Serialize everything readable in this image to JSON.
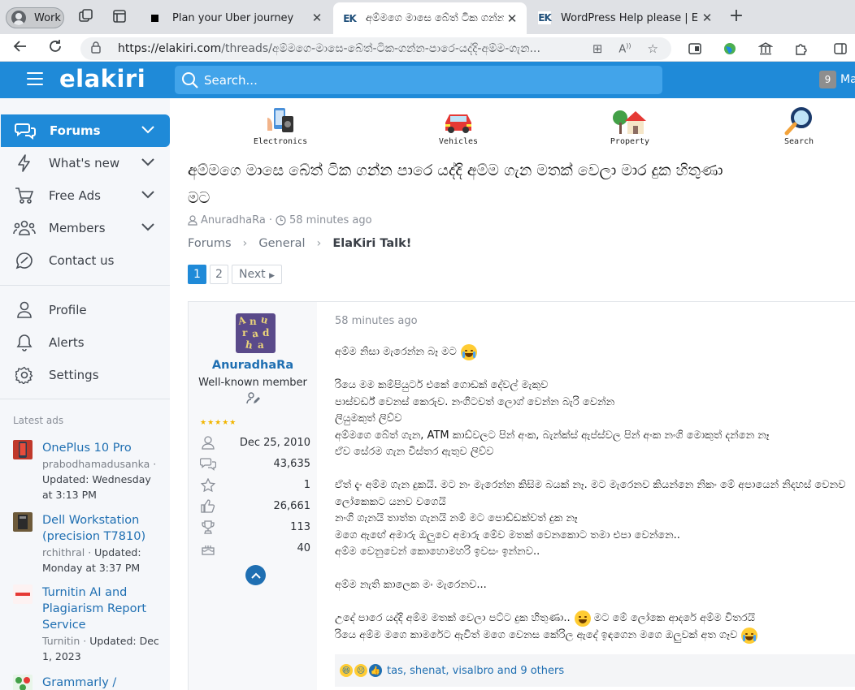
{
  "browser": {
    "profile_label": "Work",
    "tabs": [
      {
        "title": "Plan your Uber journey"
      },
      {
        "title": "අම්මගෙ මාසෙ බේත් ටික ගන්න"
      },
      {
        "title": "WordPress Help please | ElaKiri"
      }
    ],
    "url_host": "https://elakiri.com",
    "url_path": "/threads/අම්මගෙ-මාසෙ-බේත්-ටික-ගන්න-පාරෙ-යද්දි-අම්ම-ගැන..."
  },
  "header": {
    "logo": "elakiri",
    "search_placeholder": "Search...",
    "notification_count": "9",
    "user_truncated": "Ma"
  },
  "sidebar": {
    "items": [
      {
        "label": "Forums"
      },
      {
        "label": "What's new"
      },
      {
        "label": "Free Ads"
      },
      {
        "label": "Members"
      },
      {
        "label": "Contact us"
      },
      {
        "label": "Profile"
      },
      {
        "label": "Alerts"
      },
      {
        "label": "Settings"
      }
    ],
    "latest_ads_title": "Latest ads",
    "ads": [
      {
        "title": "OnePlus 10 Pro",
        "author": "prabodhamadusanka",
        "meta": "Updated: Wednesday at 3:13 PM"
      },
      {
        "title": "Dell Workstation (precision T7810)",
        "author": "rchithral",
        "meta": "Updated: Monday at 3:37 PM"
      },
      {
        "title": "Turnitin AI and Plagiarism Report Service",
        "author": "Turnitin",
        "meta": "Updated: Dec 1, 2023"
      },
      {
        "title": "Grammarly / QuillBot"
      }
    ]
  },
  "categories": [
    {
      "label": "Electronics"
    },
    {
      "label": "Vehicles"
    },
    {
      "label": "Property"
    },
    {
      "label": "Search"
    }
  ],
  "thread": {
    "title_line1": "අම්මගෙ මාසෙ බේත් ටික ගන්න පාරෙ යද්දි අම්ම ගැන මතක් වෙලා මාර දුක හිතුණා",
    "title_line2": "මට",
    "author": "AnuradhaRa",
    "time": "58 minutes ago",
    "breadcrumbs": [
      "Forums",
      "General",
      "ElaKiri Talk!"
    ],
    "pages": [
      "1",
      "2"
    ],
    "next_label": "Next"
  },
  "post": {
    "user": {
      "name": "AnuradhaRa",
      "title": "Well-known member",
      "joined": "Dec 25, 2010",
      "messages": "43,635",
      "points": "1",
      "reactions": "26,661",
      "trophies": "113",
      "age": "40"
    },
    "date": "58 minutes ago",
    "lines": [
      "අම්ම නිසා මැරෙන්න බෑ මට",
      "",
      "රියෙ මම කම්පියුටර් එකේ ගොඩක් දේවල් මැකුව",
      "පාස්වර්ඩ් වෙනස් කෙරුව. නංගිටවත් ලොග් වෙන්න බැරි වෙන්න",
      "ලියුමකුත් ලිව්ව",
      "අම්මගෙ බේත් ගැන, ATM කාඩ්වලට පින් අංක, බැන්ක්ස් ඇප්ස්වල පින් අංක නංගි මොකුත් දන්නෙ නෑ",
      "ඒව සේරම ගැන විස්තර ඇතුව ලිව්ව",
      "",
      "ඒත් දැං අම්ම ගැන දුකයි. මට නං මැරෙන්න කිසිම බයක් නෑ. මට මැරෙනව කියන්නෙ නිකං මේ අපායෙන් නිදහස් වෙනව",
      "ලෝකෙකට යනව වගෙයි",
      "නංගි ගැනයි තාත්ත ගැනයි නම් මට පොඩ්ඩක්වත් දුක නෑ",
      "මගෙ ඇඟේ අමාරු ඔලුවෙ අමාරු මේව මතක් වෙනකොට තමා එපා වෙන්නෙ..",
      "අම්ම වෙනුවෙන් කොහොමහරි ඉවසං ඉන්නව..",
      "",
      "අම්ම නැති කාලෙක මං මැරෙනව...",
      "",
      "උදේ පාරෙ යද්දි අම්ම මතක් වෙලා පට්ට දුක හිතුණා..",
      "රියෙ අම්ම මගෙ කාමරේට ඇවිත් මගෙ වෙනස කේරිල ඇදේ ඉඳගෙන මගෙ ඔලුවක් අත ගෑව"
    ],
    "line7_after_emoji": "මට මේ ලෝකෙ ආදරේ අම්ම විතරයි",
    "reactions_text": "tas, shenat, visalbro and 9 others"
  }
}
